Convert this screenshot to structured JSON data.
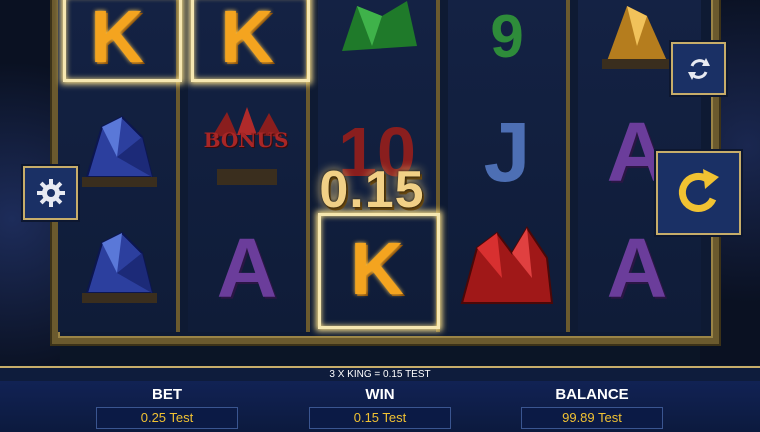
{
  "reels": [
    [
      "K",
      "gem-blue",
      "gem-blue"
    ],
    [
      "K",
      "bonus",
      "A"
    ],
    [
      "gem-green",
      "10",
      "K"
    ],
    [
      "9",
      "J",
      "gem-red"
    ],
    [
      "gem-gold",
      "A",
      "A"
    ]
  ],
  "bonus_label": "BONUS",
  "win_amount": "0.15",
  "win_line_text": "3 X KING = 0.15 TEST",
  "bottom_bar": {
    "bet_label": "BET",
    "bet_value": "0.25 Test",
    "win_label": "WIN",
    "win_value": "0.15 Test",
    "balance_label": "BALANCE",
    "balance_value": "99.89 Test"
  },
  "icons": [
    "settings-gear-icon",
    "autoplay-arrows-icon",
    "spin-arrow-icon"
  ],
  "colors": {
    "frame_gold": "#c7ad6a",
    "value_text": "#f1c232",
    "king_orange": "#f4a41f",
    "button_blue": "#1a3065"
  }
}
